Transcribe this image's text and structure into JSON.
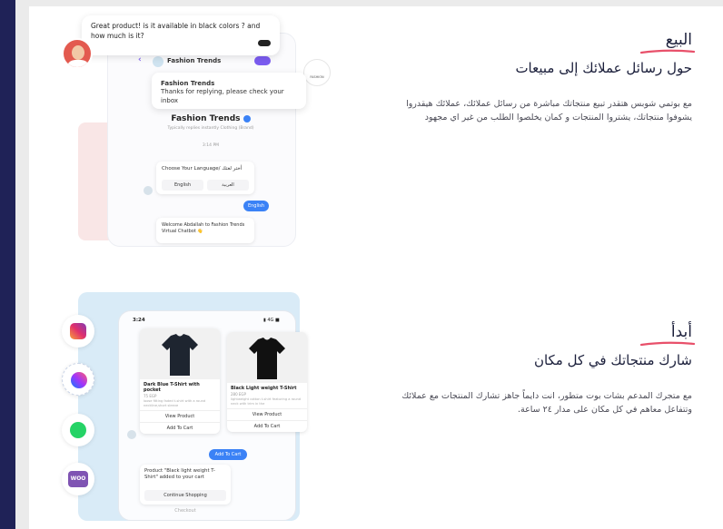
{
  "colors": {
    "sidebar": "#1f2257",
    "accent_underline": "#e8506a",
    "blue": "#3b82f6",
    "purple": "#7b5cf0"
  },
  "section1": {
    "tag": "البيع",
    "headline": "حول رسائل عملائك إلى مبيعات",
    "description": "مع بوتمي شوبس هتقدر تبيع منتجاتك مباشرة من رسائل عملائك، عملائك هيقدروا يشوفوا منتجاتك، يشتروا المنتجات و كمان يخلصوا الطلب من غير اي مجهود"
  },
  "section2": {
    "tag": "أبدأ",
    "headline": "شارك منتجاتك في كل مكان",
    "description": "مع متجرك المدعم بشات بوت متطور، انت دايماً جاهز تشارك المنتجات مع عملائك وتتفاعل معاهم في كل مكان على مدار ٢٤ ساعة."
  },
  "mockup1": {
    "customer_message": "Great product! is it available in black colors ? and how much is it?",
    "header_name": "Fashion Trends",
    "brand_circle": "FASHION",
    "reply_name": "Fashion Trends",
    "reply_text": "Thanks for replying, please check your inbox",
    "profile_name": "Fashion Trends",
    "profile_sub": "Typically replies instantly Clothing (Brand)",
    "time": "3:14 PM",
    "lang_question": "Choose Your Language/ أختر لغتك",
    "lang_english": "English",
    "lang_arabic": "العربية",
    "english_pill": "English",
    "welcome": "Welcome Abdallah to Fashion Trends Virtual Chatbot 👋"
  },
  "mockup2": {
    "status_time": "3:24",
    "status_right": "▮ 4G ■",
    "products": [
      {
        "title": "Dark Blue T-Shirt with pocket",
        "price": "75 EGP",
        "desc": "loose fitting faded t-shirt with a round neckline,short sleeve",
        "view": "View Product",
        "add": "Add To Cart",
        "color": "#1e2530"
      },
      {
        "title": "Black Light weight T-Shirt",
        "price": "280 EGP",
        "desc": "lightweight cotton t-shirt featuring a round neck with trim in the",
        "view": "View Product",
        "add": "Add To Cart",
        "color": "#111111"
      }
    ],
    "add_cart_pill": "Add To Cart",
    "cart_msg": "Product \"Black light weight T-Shirt\" added to your cart",
    "continue": "Continue Shopping",
    "checkout": "Checkout",
    "woo_label": "WOO"
  }
}
